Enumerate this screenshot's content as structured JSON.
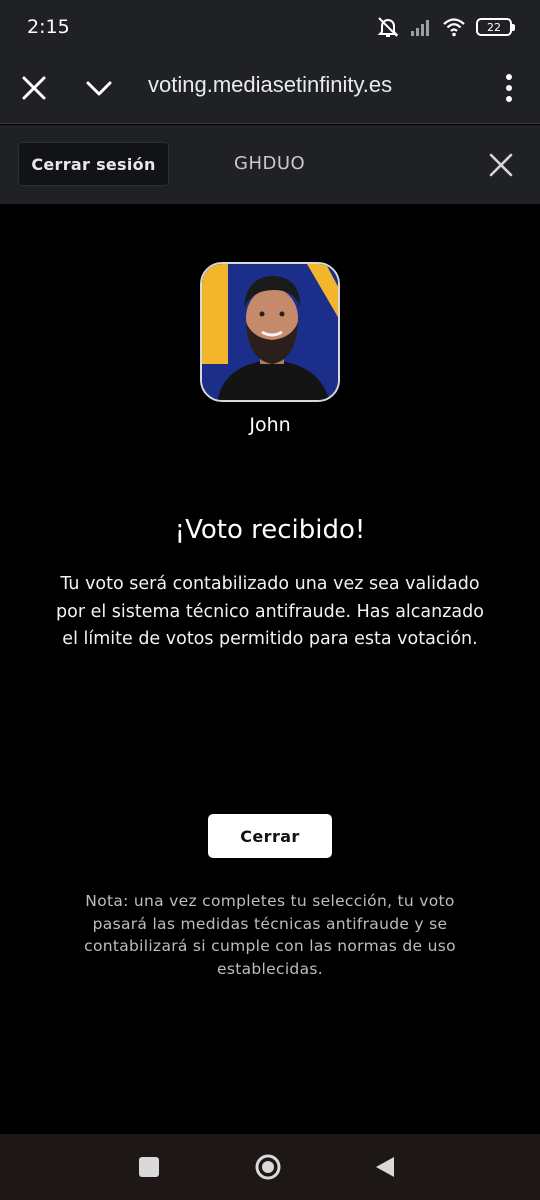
{
  "status_bar": {
    "time": "2:15",
    "battery": "22",
    "icons": [
      "mute-icon",
      "signal-icon",
      "wifi-icon",
      "battery-icon"
    ]
  },
  "browser": {
    "url": "voting.mediasetinfinity.es",
    "icons": [
      "close-icon",
      "chevron-down-icon",
      "more-vert-icon"
    ]
  },
  "header": {
    "logout_label": "Cerrar sesión",
    "show_name": "GHDUO",
    "icons": [
      "close-icon"
    ]
  },
  "candidate": {
    "name": "John"
  },
  "confirmation": {
    "title": "¡Voto recibido!",
    "message": "Tu voto será contabilizado una vez sea validado por el sistema técnico antifraude. Has alcanzado el límite de votos permitido para esta votación.",
    "close_label": "Cerrar",
    "note": "Nota: una vez completes tu selección, tu voto pasará las medidas técnicas antifraude y se contabilizará si cumple con las normas de uso establecidas."
  },
  "nav_bar": {
    "icons": [
      "recents-icon",
      "home-icon",
      "back-icon"
    ]
  },
  "colors": {
    "background": "#000000",
    "chrome_bar": "#202124",
    "header_bar": "#1f2124",
    "avatar_blue": "#1b2e8a",
    "avatar_yellow": "#f2b52b"
  }
}
